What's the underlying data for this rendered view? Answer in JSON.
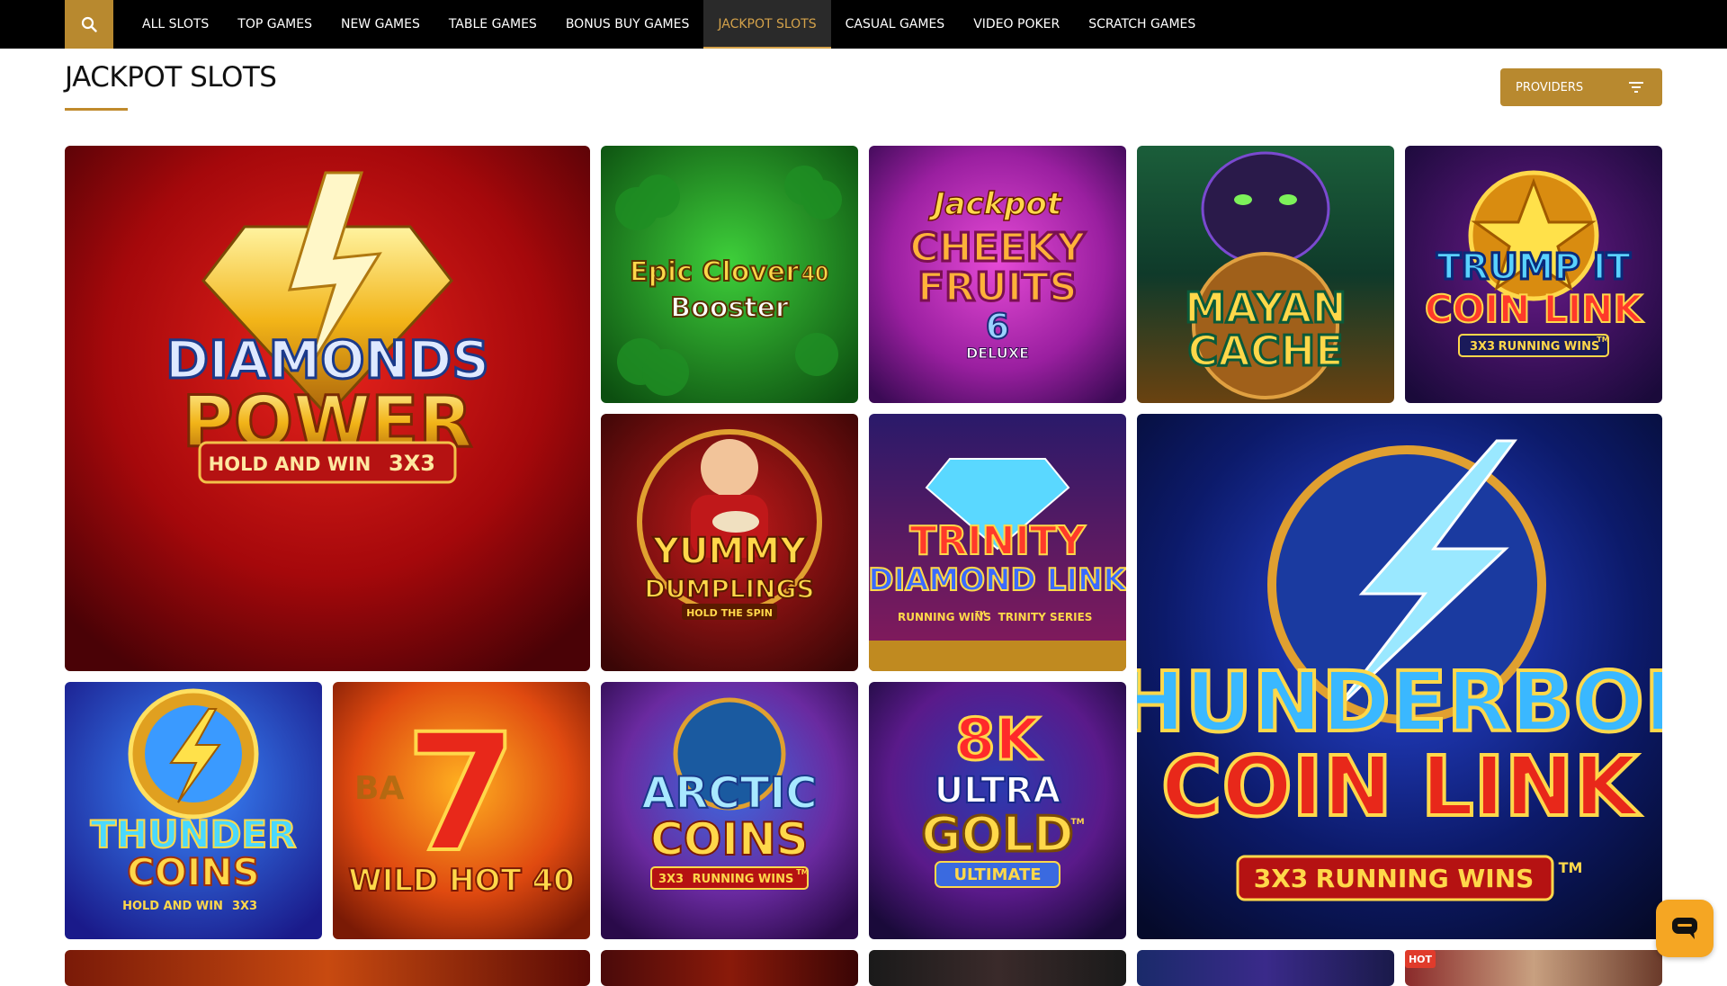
{
  "nav": {
    "search_icon": "search-icon",
    "items": [
      {
        "label": "ALL SLOTS"
      },
      {
        "label": "TOP GAMES"
      },
      {
        "label": "NEW GAMES"
      },
      {
        "label": "TABLE GAMES"
      },
      {
        "label": "BONUS BUY GAMES"
      },
      {
        "label": "JACKPOT SLOTS",
        "active": true
      },
      {
        "label": "CASUAL GAMES"
      },
      {
        "label": "VIDEO POKER"
      },
      {
        "label": "SCRATCH GAMES"
      }
    ]
  },
  "page": {
    "title": "JACKPOT SLOTS",
    "providers_label": "PROVIDERS",
    "providers_icon": "filter-icon"
  },
  "games": [
    {
      "line1": "DIAMONDS",
      "line2": "POWER",
      "line3": "HOLD AND WIN",
      "line4": "3X3"
    },
    {
      "line1": "Epic Clover",
      "line2": "40",
      "line3": "Booster"
    },
    {
      "line1": "Jackpot",
      "line2": "CHEEKY",
      "line3": "FRUITS",
      "line4": "6",
      "line5": "DELUXE"
    },
    {
      "line1": "MAYAN",
      "line2": "CACHE"
    },
    {
      "line1": "TRUMP IT",
      "line2": "COIN LINK",
      "line3": "3X3",
      "line4": "RUNNING WINS",
      "line5": "TM"
    },
    {
      "line1": "YUMMY",
      "line2": "DUMPLINGS",
      "line3": "HOLD THE SPIN"
    },
    {
      "line1": "TRINITY",
      "line2": "DIAMOND LINK",
      "line3": "RUNNING WINS",
      "line4": "TM",
      "line5": "TRINITY SERIES"
    },
    {
      "line1": "THUNDERBOLT",
      "line2": "COIN LINK",
      "line3": "3X3",
      "line4": "RUNNING WINS",
      "line5": "TM"
    },
    {
      "line1": "THUNDER",
      "line2": "COINS",
      "line3": "HOLD AND WIN",
      "line4": "3X3"
    },
    {
      "line1": "7",
      "line2": "WILD HOT 40",
      "line3": "BA"
    },
    {
      "line1": "ARCTIC",
      "line2": "COINS",
      "line3": "3X3",
      "line4": "RUNNING WINS",
      "line5": "TM"
    },
    {
      "line1": "8K",
      "line2": "ULTRA",
      "line3": "GOLD",
      "line4": "ULTIMATE",
      "line5": "TM"
    }
  ],
  "badges": {
    "hot": "HOT"
  },
  "chat": {
    "icon": "chat-icon"
  },
  "colors": {
    "accent": "#b8892f",
    "nav_bg": "#000000",
    "active_text": "#d4a24a"
  }
}
